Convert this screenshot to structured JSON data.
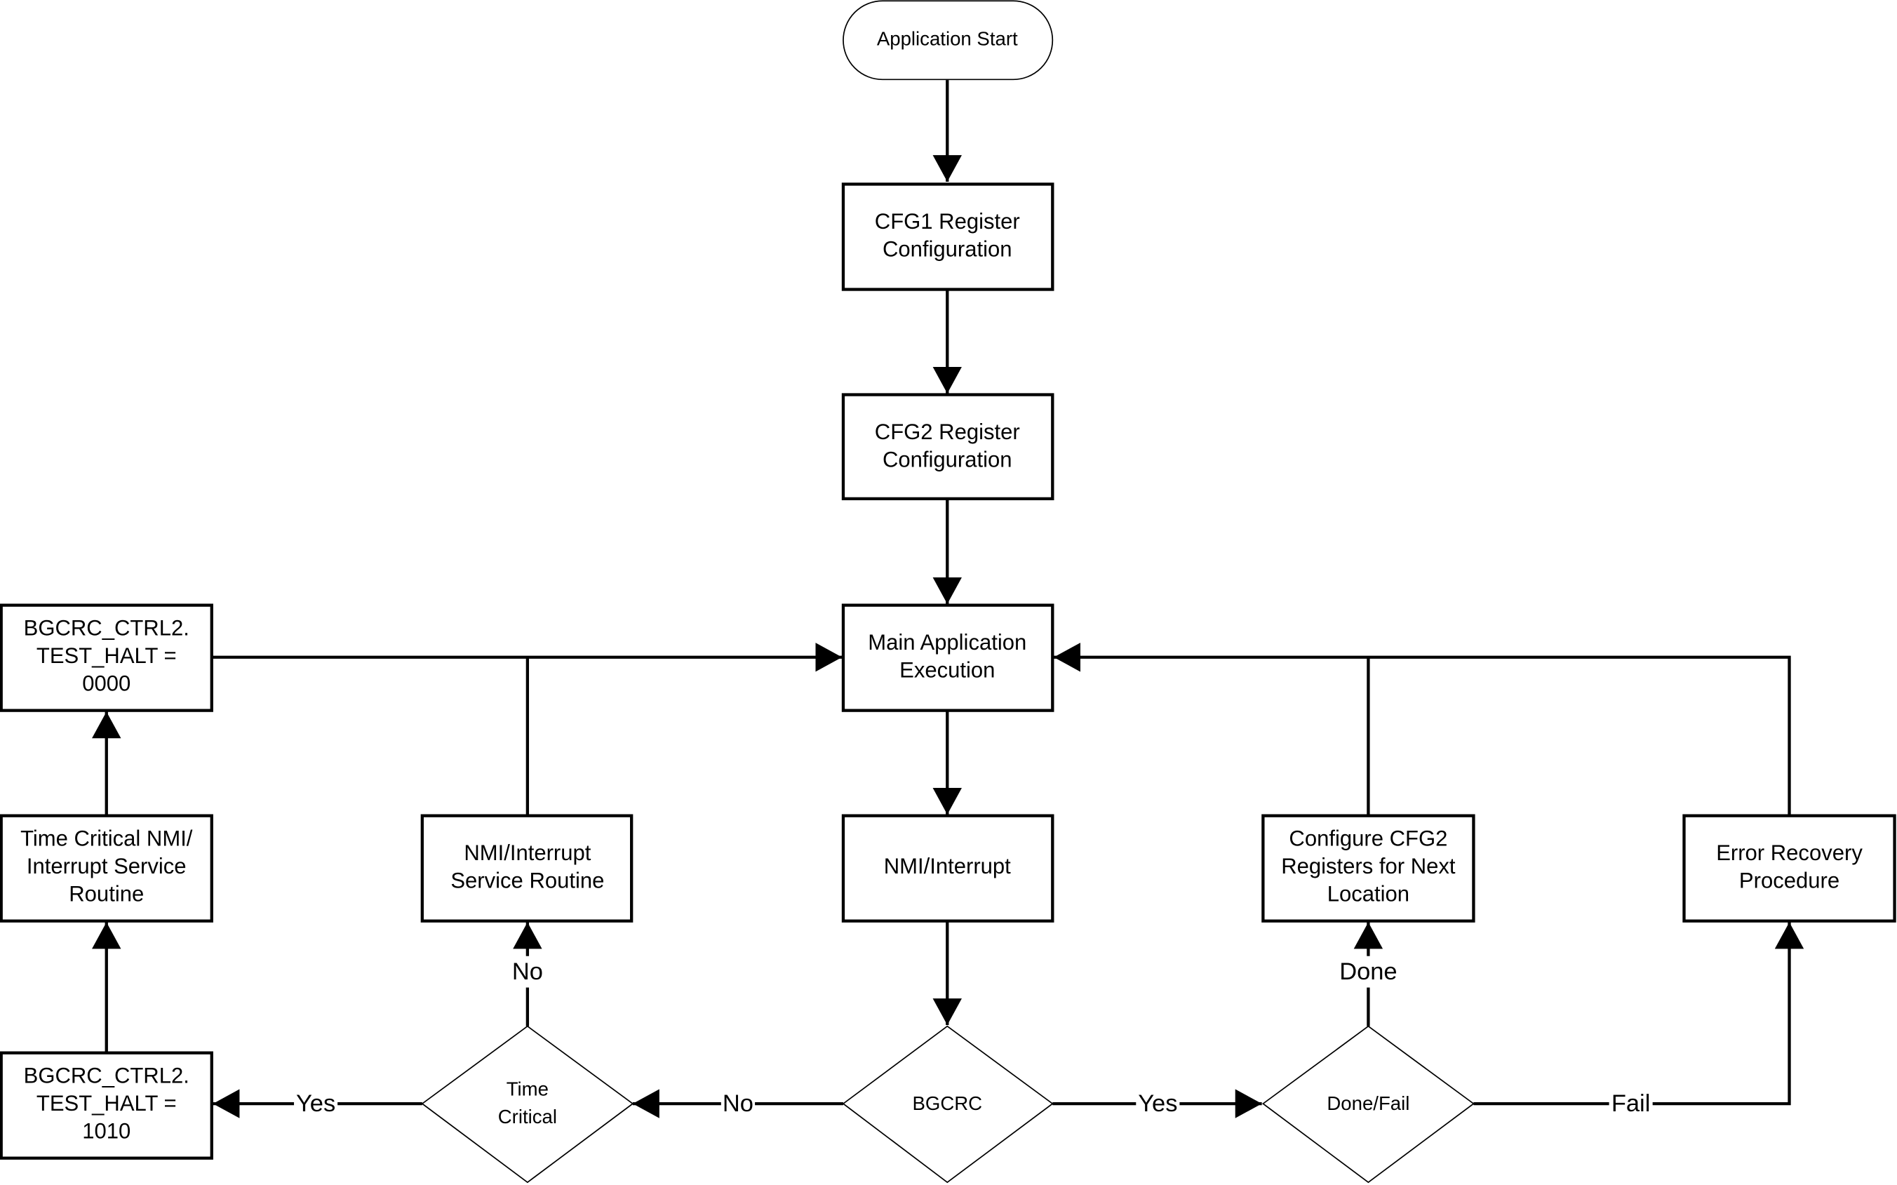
{
  "nodes": {
    "start": {
      "label": "Application Start"
    },
    "cfg1": {
      "line1": "CFG1 Register",
      "line2": "Configuration"
    },
    "cfg2": {
      "line1": "CFG2 Register",
      "line2": "Configuration"
    },
    "main": {
      "line1": "Main Application",
      "line2": "Execution"
    },
    "nmi": {
      "label": "NMI/Interrupt"
    },
    "bgcrc": {
      "label": "BGCRC"
    },
    "done_fail": {
      "label": "Done/Fail"
    },
    "time_critical": {
      "line1": "Time",
      "line2": "Critical"
    },
    "halt_1010": {
      "line1": "BGCRC_CTRL2.",
      "line2": "TEST_HALT =",
      "line3": "1010"
    },
    "tc_isr": {
      "line1": "Time Critical NMI/",
      "line2": "Interrupt Service",
      "line3": "Routine"
    },
    "halt_0000": {
      "line1": "BGCRC_CTRL2.",
      "line2": "TEST_HALT =",
      "line3": "0000"
    },
    "isr": {
      "line1": "NMI/Interrupt",
      "line2": "Service Routine"
    },
    "next_loc": {
      "line1": "Configure CFG2",
      "line2": "Registers for Next",
      "line3": "Location"
    },
    "error": {
      "line1": "Error Recovery",
      "line2": "Procedure"
    }
  },
  "edges": {
    "bgcrc_no": "No",
    "bgcrc_yes": "Yes",
    "fail": "Fail",
    "done": "Done",
    "tc_yes": "Yes",
    "tc_no": "No"
  }
}
